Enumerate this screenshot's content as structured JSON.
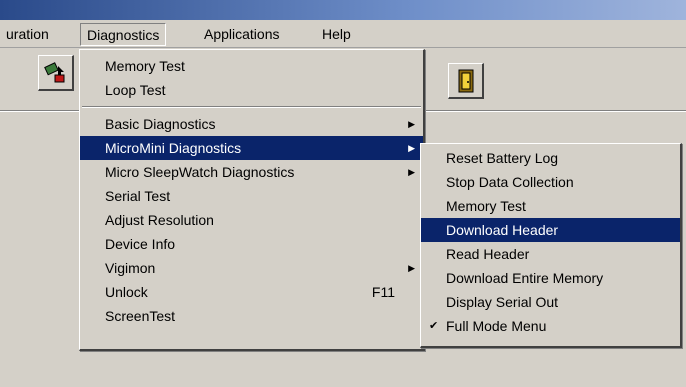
{
  "menubar": {
    "items": [
      {
        "label": "uration"
      },
      {
        "label": "Diagnostics"
      },
      {
        "label": "Applications"
      },
      {
        "label": "Help"
      }
    ]
  },
  "toolbar": {
    "buttons": [
      {
        "icon": "device-transfer-icon"
      },
      {
        "icon": "exit-door-icon"
      }
    ]
  },
  "diagnostics_menu": {
    "group1": [
      {
        "label": "Memory Test"
      },
      {
        "label": "Loop Test"
      }
    ],
    "group2": [
      {
        "label": "Basic Diagnostics",
        "submenu": true
      },
      {
        "label": "MicroMini Diagnostics",
        "submenu": true,
        "highlighted": true
      },
      {
        "label": "Micro SleepWatch Diagnostics",
        "submenu": true
      },
      {
        "label": "Serial Test"
      },
      {
        "label": "Adjust Resolution"
      },
      {
        "label": "Device Info"
      },
      {
        "label": "Vigimon",
        "submenu": true
      },
      {
        "label": "Unlock",
        "shortcut": "F11"
      },
      {
        "label": "ScreenTest"
      }
    ]
  },
  "micromini_submenu": {
    "items": [
      {
        "label": "Reset Battery Log"
      },
      {
        "label": "Stop Data Collection"
      },
      {
        "label": "Memory Test"
      },
      {
        "label": "Download Header",
        "highlighted": true
      },
      {
        "label": "Read Header"
      },
      {
        "label": "Download Entire Memory"
      },
      {
        "label": "Display Serial Out"
      },
      {
        "label": "Full Mode Menu",
        "checked": true
      }
    ]
  },
  "colors": {
    "menu_bg": "#d4d0c8",
    "highlight": "#0a246a",
    "highlight_text": "#ffffff"
  }
}
